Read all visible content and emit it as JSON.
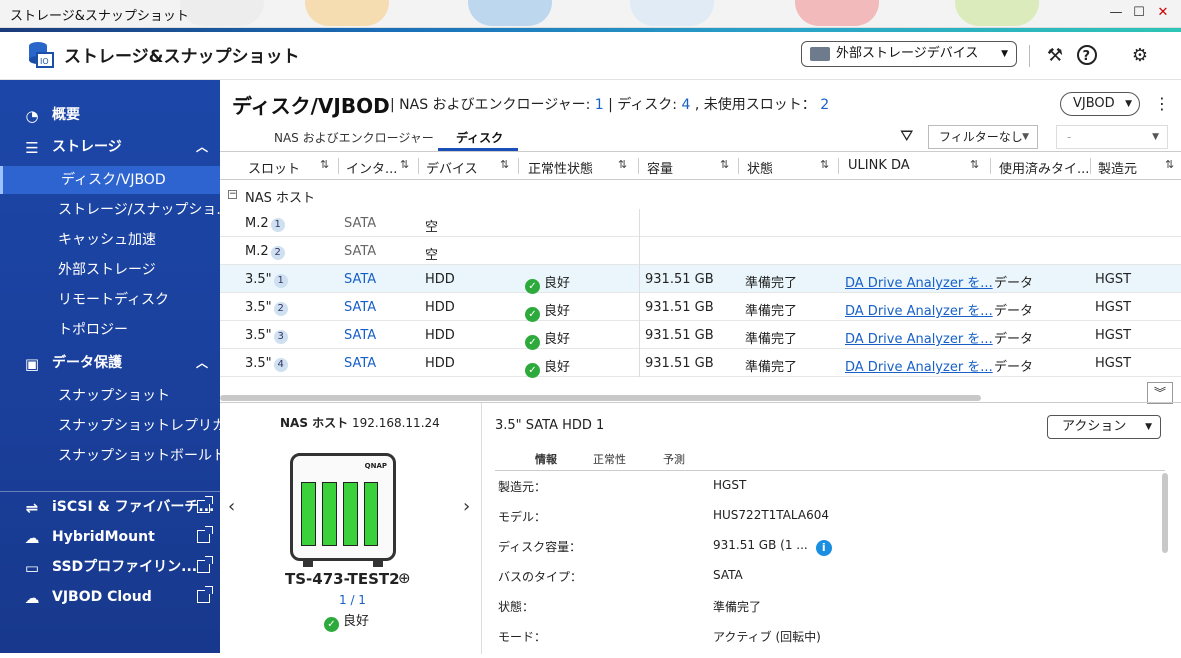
{
  "window": {
    "title": "ストレージ&スナップショット",
    "minimize": "—",
    "maximize": "☐",
    "close": "✕"
  },
  "header": {
    "app_title": "ストレージ&スナップショット",
    "external_device_label": "外部ストレージデバイス",
    "icons": [
      "wand-icon",
      "help-icon",
      "settings-icon"
    ]
  },
  "sidebar": {
    "items": [
      {
        "label": "概要",
        "icon": "dashboard-icon"
      },
      {
        "label": "ストレージ",
        "icon": "storage-icon",
        "chevron": "︿"
      },
      {
        "label": "ディスク/VJBOD"
      },
      {
        "label": "ストレージ/スナップショ..."
      },
      {
        "label": "キャッシュ加速"
      },
      {
        "label": "外部ストレージ"
      },
      {
        "label": "リモートディスク"
      },
      {
        "label": "トポロジー"
      },
      {
        "label": "データ保護",
        "icon": "data-protection-icon",
        "chevron": "︿"
      },
      {
        "label": "スナップショット"
      },
      {
        "label": "スナップショットレプリカ"
      },
      {
        "label": "スナップショットボールト"
      },
      {
        "label": "iSCSI & ファイバーチ..."
      },
      {
        "label": "HybridMount"
      },
      {
        "label": "SSDプロファイリン..."
      },
      {
        "label": "VJBOD Cloud"
      }
    ]
  },
  "page": {
    "title": "ディスク/VJBOD",
    "info_prefix": "| NAS およびエンクロージャー: ",
    "enclosures": "1",
    "info_disk": " | ディスク: ",
    "disks": "4",
    "info_unused": " , 未使用スロット： ",
    "unused_slots": "2",
    "vjbod_button": "VJBOD"
  },
  "tabs": [
    {
      "label": "NAS およびエンクロージャー"
    },
    {
      "label": "ディスク"
    }
  ],
  "filter": {
    "value": "フィルターなし",
    "second": "-"
  },
  "table": {
    "columns": [
      "スロット",
      "インタ...",
      "デバイス",
      "正常性状態",
      "容量",
      "状態",
      "ULINK DA",
      "使用済みタイ...",
      "製造元"
    ],
    "group": "NAS ホスト",
    "rows": [
      {
        "slot": "M.2",
        "n": "1",
        "iface": "SATA",
        "device": "空"
      },
      {
        "slot": "M.2",
        "n": "2",
        "iface": "SATA",
        "device": "空"
      },
      {
        "slot": "3.5\"",
        "n": "1",
        "iface": "SATA",
        "device": "HDD",
        "health": "良好",
        "capacity": "931.51 GB",
        "status": "準備完了",
        "ulink": "DA Drive Analyzer を...",
        "usage": "データ",
        "vendor": "HGST"
      },
      {
        "slot": "3.5\"",
        "n": "2",
        "iface": "SATA",
        "device": "HDD",
        "health": "良好",
        "capacity": "931.51 GB",
        "status": "準備完了",
        "ulink": "DA Drive Analyzer を...",
        "usage": "データ",
        "vendor": "HGST"
      },
      {
        "slot": "3.5\"",
        "n": "3",
        "iface": "SATA",
        "device": "HDD",
        "health": "良好",
        "capacity": "931.51 GB",
        "status": "準備完了",
        "ulink": "DA Drive Analyzer を...",
        "usage": "データ",
        "vendor": "HGST"
      },
      {
        "slot": "3.5\"",
        "n": "4",
        "iface": "SATA",
        "device": "HDD",
        "health": "良好",
        "capacity": "931.51 GB",
        "status": "準備完了",
        "ulink": "DA Drive Analyzer を...",
        "usage": "データ",
        "vendor": "HGST"
      }
    ]
  },
  "device_panel": {
    "host_label": "NAS ホスト",
    "host_ip": "192.168.11.24",
    "brand": "QNAP",
    "name": "TS-473-TEST2",
    "pager": "1 / 1",
    "status": "良好"
  },
  "detail": {
    "title": "3.5\" SATA HDD 1",
    "action": "アクション",
    "subtabs": [
      "情報",
      "正常性",
      "予測"
    ],
    "fields": [
      {
        "k": "製造元：",
        "v": "HGST"
      },
      {
        "k": "モデル：",
        "v": "HUS722T1TALA604"
      },
      {
        "k": "ディスク容量：",
        "v": "931.51 GB (1 ..."
      },
      {
        "k": "バスのタイプ：",
        "v": "SATA"
      },
      {
        "k": "状態：",
        "v": "準備完了"
      },
      {
        "k": "モード：",
        "v": "アクティブ (回転中)"
      }
    ]
  },
  "colors": {
    "sidebar": "#1c47a8",
    "accent": "#1760c7",
    "ok": "#2eaa3c"
  }
}
